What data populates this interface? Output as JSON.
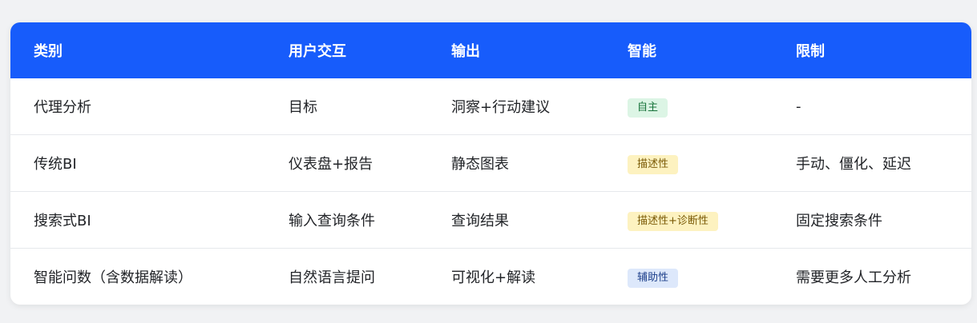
{
  "header": {
    "category": "类别",
    "interaction": "用户交互",
    "output": "输出",
    "intelligence": "智能",
    "limitation": "限制"
  },
  "rows": [
    {
      "category": "代理分析",
      "interaction": "目标",
      "output": "洞察+行动建议",
      "intelligence": "自主",
      "intelligence_color": "green",
      "limitation": "-"
    },
    {
      "category": "传统BI",
      "interaction": "仪表盘+报告",
      "output": "静态图表",
      "intelligence": "描述性",
      "intelligence_color": "yellow",
      "limitation": "手动、僵化、延迟"
    },
    {
      "category": "搜索式BI",
      "interaction": "输入查询条件",
      "output": "查询结果",
      "intelligence": "描述性+诊断性",
      "intelligence_color": "yellow",
      "limitation": "固定搜索条件"
    },
    {
      "category": "智能问数（含数据解读）",
      "interaction": "自然语言提问",
      "output": "可视化+解读",
      "intelligence": "辅助性",
      "intelligence_color": "blue",
      "limitation": "需要更多人工分析"
    }
  ],
  "colors": {
    "header_bg": "#175cfb",
    "badge_green": "#dcf5e5",
    "badge_yellow": "#fdf2c0",
    "badge_blue": "#dde8fb"
  }
}
